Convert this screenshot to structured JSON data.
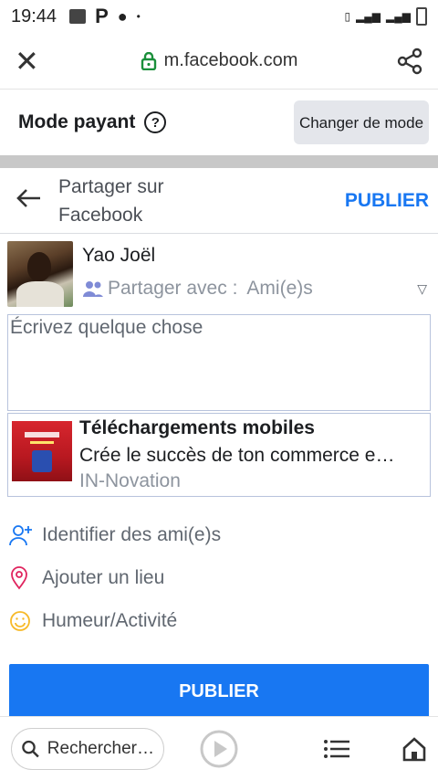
{
  "status": {
    "time": "19:44"
  },
  "browser": {
    "url": "m.facebook.com"
  },
  "mode": {
    "title": "Mode payant",
    "change_label": "Changer de mode"
  },
  "share": {
    "title": "Partager sur Facebook",
    "publish": "PUBLIER"
  },
  "user": {
    "name": "Yao Joël",
    "audience_prefix": "Partager avec :",
    "audience_value": "Ami(e)s"
  },
  "composer": {
    "placeholder": "Écrivez quelque chose"
  },
  "link": {
    "title": "Téléchargements mobiles",
    "description": "Crée le succès de ton commerce e…",
    "source": "IN-Novation"
  },
  "actions": [
    {
      "label": "Identifier des ami(e)s",
      "icon": "tag-friends-icon"
    },
    {
      "label": "Ajouter un lieu",
      "icon": "location-pin-icon"
    },
    {
      "label": "Humeur/Activité",
      "icon": "smiley-icon"
    }
  ],
  "publish_button": "PUBLIER",
  "bottom": {
    "search": "Rechercher…"
  },
  "colors": {
    "accent": "#1877f2",
    "muted": "#8d949e",
    "pin": "#e0245e",
    "smile": "#f7b928"
  }
}
